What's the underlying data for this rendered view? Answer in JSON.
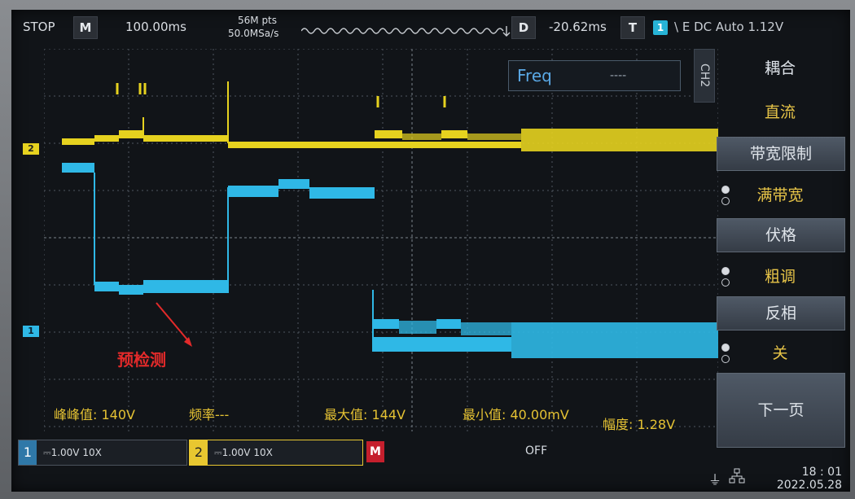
{
  "topbar": {
    "run_state": "STOP",
    "mode": "M",
    "timebase": "100.00ms",
    "mem_depth": "56M pts",
    "sample_rate": "50.0MSa/s",
    "delay_label": "D",
    "delay_value": "-20.62ms",
    "trigger_label": "T",
    "trigger_channel": "1",
    "trigger_settings": "\\ E DC Auto  1.12V"
  },
  "measure_box": {
    "label": "Freq",
    "value": "----"
  },
  "side_panel": {
    "tab": "CH2",
    "items": [
      {
        "title": "耦合",
        "value": "直流"
      },
      {
        "title": "带宽限制",
        "value": "满带宽"
      },
      {
        "title": "伏格",
        "value": "粗调"
      },
      {
        "title": "反相",
        "value": "关"
      }
    ],
    "next_page": "下一页"
  },
  "measurements": {
    "vpp": "峰峰值: 140V",
    "freq": "频率---",
    "vmax": "最大值: 144V",
    "vmin": "最小值: 40.00mV",
    "amp": "幅度: 1.28V"
  },
  "annotation": "预检测",
  "channel_markers": {
    "ch2": "2",
    "ch1": "1"
  },
  "bottombar": {
    "ch1": {
      "num": "1",
      "setting": "⎓1.00V  10X"
    },
    "ch2": {
      "num": "2",
      "setting": "⎓1.00V  10X"
    },
    "math": "M",
    "ref_state": "OFF",
    "time": "18 : 01",
    "date": "2022.05.28"
  },
  "colors": {
    "ch1": "#2fb8e6",
    "ch2": "#e6d21f",
    "annotation": "#e32a2a",
    "measure_text": "#e5c233"
  },
  "icons": [
    "usb-icon",
    "network-icon",
    "trigger-edge-icon"
  ]
}
